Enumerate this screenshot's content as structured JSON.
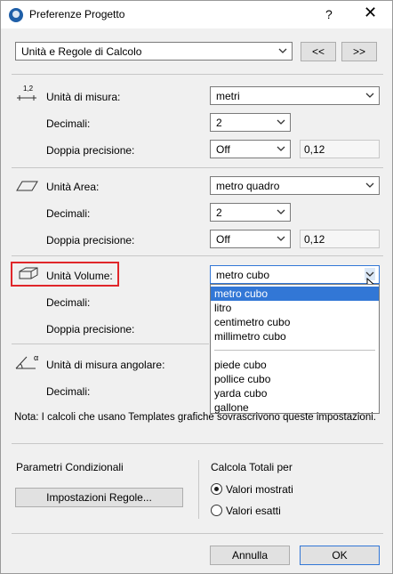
{
  "window": {
    "title": "Preferenze Progetto",
    "help_label": "?",
    "close_label": "✕"
  },
  "nav": {
    "page_select": "Unità e Regole di Calcolo",
    "prev_label": "<<",
    "next_label": ">>"
  },
  "length": {
    "label": "Unità di misura:",
    "unit": "metri",
    "decimals_label": "Decimali:",
    "decimals": "2",
    "double_label": "Doppia precisione:",
    "double": "Off",
    "double_value": "0,12",
    "icon_text": "1,2"
  },
  "area": {
    "label": "Unità Area:",
    "unit": "metro quadro",
    "decimals_label": "Decimali:",
    "decimals": "2",
    "double_label": "Doppia precisione:",
    "double": "Off",
    "double_value": "0,12"
  },
  "volume": {
    "label": "Unità Volume:",
    "unit": "metro cubo",
    "decimals_label": "Decimali:",
    "double_label": "Doppia precisione:",
    "options_group1": [
      "metro cubo",
      "litro",
      "centimetro cubo",
      "millimetro cubo"
    ],
    "options_group2": [
      "piede cubo",
      "pollice cubo",
      "yarda cubo",
      "gallone"
    ]
  },
  "angle": {
    "label": "Unità di misura angolare:",
    "decimals_label": "Decimali:",
    "icon_text": "α"
  },
  "note": "Nota: I calcoli che usano Templates grafiche sovrascrivono queste impostazioni.",
  "conditional": {
    "title": "Parametri Condizionali",
    "button": "Impostazioni Regole..."
  },
  "totals": {
    "title": "Calcola Totali per",
    "option_shown": "Valori mostrati",
    "option_exact": "Valori esatti",
    "selected": "Valori mostrati"
  },
  "footer": {
    "cancel": "Annulla",
    "ok": "OK"
  },
  "colors": {
    "highlight_border": "#e0262a",
    "selection": "#3277d6"
  }
}
